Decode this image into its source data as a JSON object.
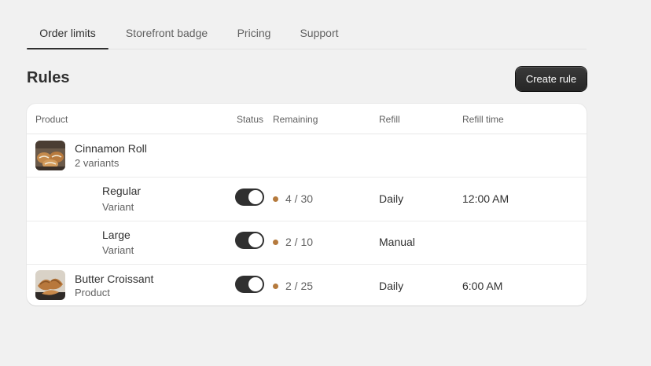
{
  "tabs": [
    {
      "label": "Order limits",
      "active": true
    },
    {
      "label": "Storefront badge",
      "active": false
    },
    {
      "label": "Pricing",
      "active": false
    },
    {
      "label": "Support",
      "active": false
    }
  ],
  "page_title": "Rules",
  "create_button": "Create rule",
  "table": {
    "headers": [
      "Product",
      "Status",
      "Remaining",
      "Refill",
      "Refill time"
    ],
    "rows": [
      {
        "kind": "product",
        "name": "Cinnamon Roll",
        "subtitle": "2 variants",
        "thumb_icon": "cinnamon-roll-thumbnail"
      },
      {
        "kind": "variant",
        "name": "Regular",
        "subtitle": "Variant",
        "enabled": true,
        "remaining": "4 / 30",
        "refill": "Daily",
        "refill_time": "12:00 AM"
      },
      {
        "kind": "variant",
        "name": "Large",
        "subtitle": "Variant",
        "enabled": true,
        "remaining": "2 / 10",
        "refill": "Manual",
        "refill_time": ""
      },
      {
        "kind": "product",
        "name": "Butter Croissant",
        "subtitle": "Product",
        "thumb_icon": "butter-croissant-thumbnail",
        "enabled": true,
        "remaining": "2 / 25",
        "refill": "Daily",
        "refill_time": "6:00 AM"
      }
    ]
  },
  "colors": {
    "remaining_dot": "#b57a3d",
    "toggle_on": "#303030",
    "button_bg": "#303030"
  }
}
